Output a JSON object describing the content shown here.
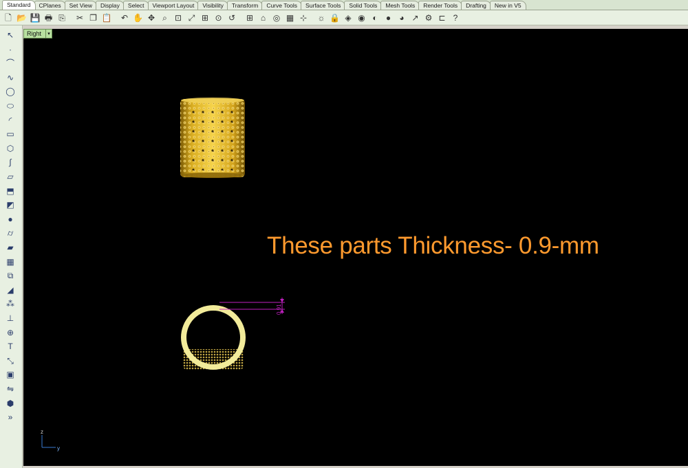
{
  "tabs": [
    "Standard",
    "CPlanes",
    "Set View",
    "Display",
    "Select",
    "Viewport Layout",
    "Visibility",
    "Transform",
    "Curve Tools",
    "Surface Tools",
    "Solid Tools",
    "Mesh Tools",
    "Render Tools",
    "Drafting",
    "New in V5"
  ],
  "active_tab": "Standard",
  "viewport": {
    "name": "Right",
    "annotation": "These parts Thickness- 0.9-mm",
    "dimension_label": "0.91",
    "axis_z": "z",
    "axis_y": "y"
  },
  "colors": {
    "annotation": "#ff9a2e",
    "dimension": "#c020c0",
    "ring": "#f2eb9a",
    "gold": "#c9a21e"
  },
  "toolbar_icons": [
    "new-file-icon",
    "open-file-icon",
    "save-icon",
    "print-icon",
    "import-icon",
    "cut-icon",
    "copy-icon",
    "paste-icon",
    "undo-icon",
    "pan-icon",
    "rotate-view-icon",
    "zoom-icon",
    "zoom-window-icon",
    "zoom-extents-icon",
    "zoom-all-icon",
    "zoom-selected-icon",
    "undo-view-icon",
    "four-viewports-icon",
    "cplane-icon",
    "snap-icon",
    "grid-icon",
    "osnap-icon",
    "light-icon",
    "lock-icon",
    "layer-icon",
    "render-color-icon",
    "material-icon",
    "sphere-render-icon",
    "render-icon",
    "dimension-icon",
    "settings-icon",
    "object-properties-icon",
    "help-icon"
  ],
  "left_icons": [
    "select-arrow-icon",
    "point-icon",
    "polyline-icon",
    "curve-icon",
    "circle-icon",
    "ellipse-icon",
    "arc-icon",
    "rectangle-icon",
    "polygon-icon",
    "free-curve-icon",
    "surface-icon",
    "extrude-icon",
    "box-icon",
    "sphere-icon",
    "cylinder-icon",
    "plane-surface-icon",
    "mesh-icon",
    "boolean-icon",
    "fillet-icon",
    "array-icon",
    "split-icon",
    "group-icon",
    "text-icon",
    "transform-icon",
    "block-icon",
    "mirror-icon",
    "solid-icon",
    "more-icon"
  ]
}
